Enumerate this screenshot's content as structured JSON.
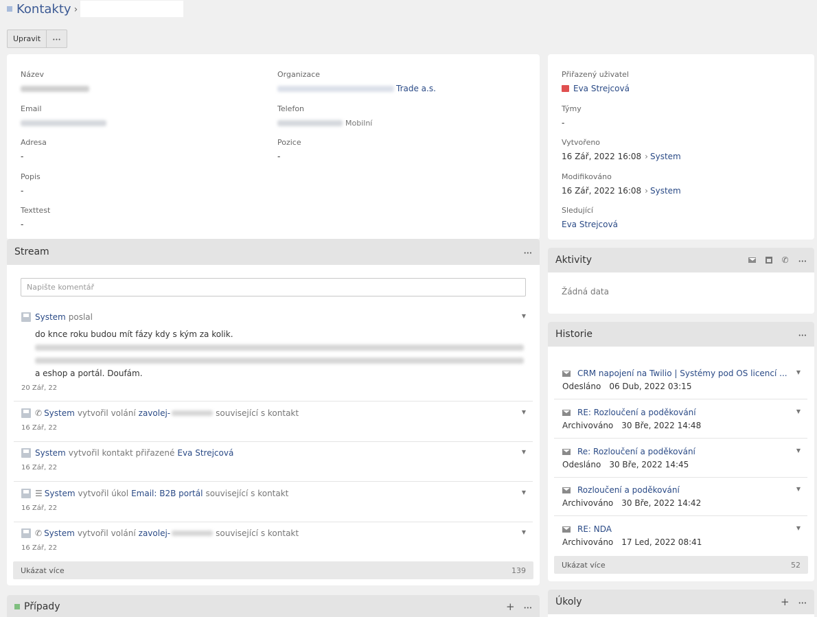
{
  "header": {
    "module": "Kontakty",
    "separator": "›"
  },
  "toolbar": {
    "edit_label": "Upravit"
  },
  "detail": {
    "name_label": "Název",
    "org_label": "Organizace",
    "org_suffix": "Trade a.s.",
    "email_label": "Email",
    "phone_label": "Telefon",
    "phone_type": "Mobilní",
    "address_label": "Adresa",
    "address_value": "-",
    "position_label": "Pozice",
    "position_value": "-",
    "desc_label": "Popis",
    "desc_value": "-",
    "texttest_label": "Texttest",
    "texttest_value": "-"
  },
  "side": {
    "assigned_label": "Přiřazený uživatel",
    "assigned_user": "Eva Strejcová",
    "teams_label": "Týmy",
    "teams_value": "-",
    "created_label": "Vytvořeno",
    "created_value": "16 Zář, 2022 16:08",
    "created_by": "System",
    "modified_label": "Modifikováno",
    "modified_value": "16 Zář, 2022 16:08",
    "modified_by": "System",
    "followers_label": "Sledující",
    "followers_value": "Eva Strejcová"
  },
  "stream": {
    "title": "Stream",
    "placeholder": "Napište komentář",
    "post": {
      "user": "System",
      "action": "poslal",
      "line1": "do knce roku budou mít fázy kdy s kým za kolik.",
      "line_end": "a eshop a portál. Doufám.",
      "date": "20 Zář, 22"
    },
    "notes": [
      {
        "user": "System",
        "action": "vytvořil volání",
        "link": "zavolej-",
        "tail": "související s kontakt",
        "date": "16 Zář, 22"
      },
      {
        "user": "System",
        "action": "vytvořil kontakt přiřazené",
        "link": "Eva Strejcová",
        "tail": "",
        "date": "16 Zář, 22"
      },
      {
        "user": "System",
        "action": "vytvořil úkol",
        "link": "Email: B2B portál",
        "tail": "související s kontakt",
        "date": "16 Zář, 22"
      },
      {
        "user": "System",
        "action": "vytvořil volání",
        "link": "zavolej-",
        "tail": "související s kontakt",
        "date": "16 Zář, 22"
      }
    ],
    "show_more": "Ukázat více",
    "count": "139"
  },
  "activities": {
    "title": "Aktivity",
    "empty": "Žádná data"
  },
  "history": {
    "title": "Historie",
    "items": [
      {
        "title": "CRM napojení na Twilio | Systémy pod OS licencí ...",
        "status": "Odesláno",
        "date": "06 Dub, 2022 03:15"
      },
      {
        "title": "RE: Rozloučení a poděkování",
        "status": "Archivováno",
        "date": "30 Bře, 2022 14:48"
      },
      {
        "title": "Re: Rozloučení a poděkování",
        "status": "Odesláno",
        "date": "30 Bře, 2022 14:45"
      },
      {
        "title": "Rozloučení a poděkování",
        "status": "Archivováno",
        "date": "30 Bře, 2022 14:42"
      },
      {
        "title": "RE: NDA",
        "status": "Archivováno",
        "date": "17 Led, 2022 08:41"
      }
    ],
    "show_more": "Ukázat více",
    "count": "52"
  },
  "cases": {
    "title": "Případy"
  },
  "tasks": {
    "title": "Úkoly"
  },
  "icons": {
    "plus": "+",
    "phone": "✆",
    "tasklist": "☰",
    "caret": "▼",
    "chevron": "›"
  },
  "colors": {
    "accent": "#2a4a86",
    "panel_head": "#e4e4e4",
    "assigned_icon": "#e05050"
  }
}
